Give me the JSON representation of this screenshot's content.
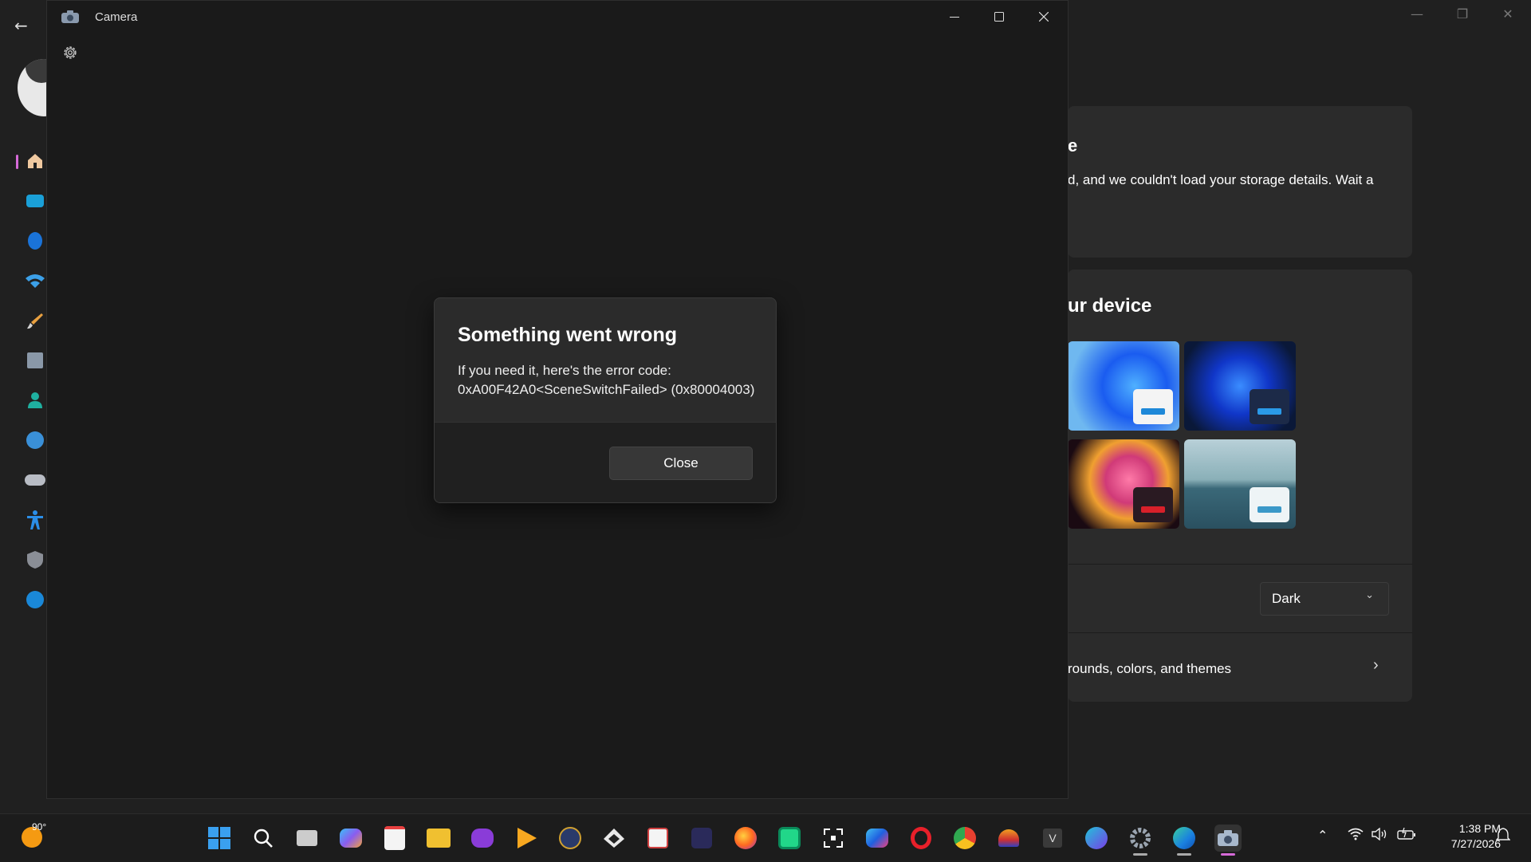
{
  "settings": {
    "storage_card_heading_fragment": "e",
    "storage_card_text": "d, and we couldn't load your storage details. Wait a",
    "device_card_heading": "ur device",
    "mode_select_value": "Dark",
    "personalize_link_text": "rounds, colors, and themes"
  },
  "camera_window": {
    "title": "Camera"
  },
  "dialog": {
    "title": "Something went wrong",
    "message_line1": "If you need it, here's the error code:",
    "message_line2": "0xA00F42A0<SceneSwitchFailed> (0x80004003)",
    "close_label": "Close"
  },
  "taskbar": {
    "weather_temp": "90°",
    "clock_time": "1:38 PM",
    "clock_date": "7/27/2026"
  }
}
